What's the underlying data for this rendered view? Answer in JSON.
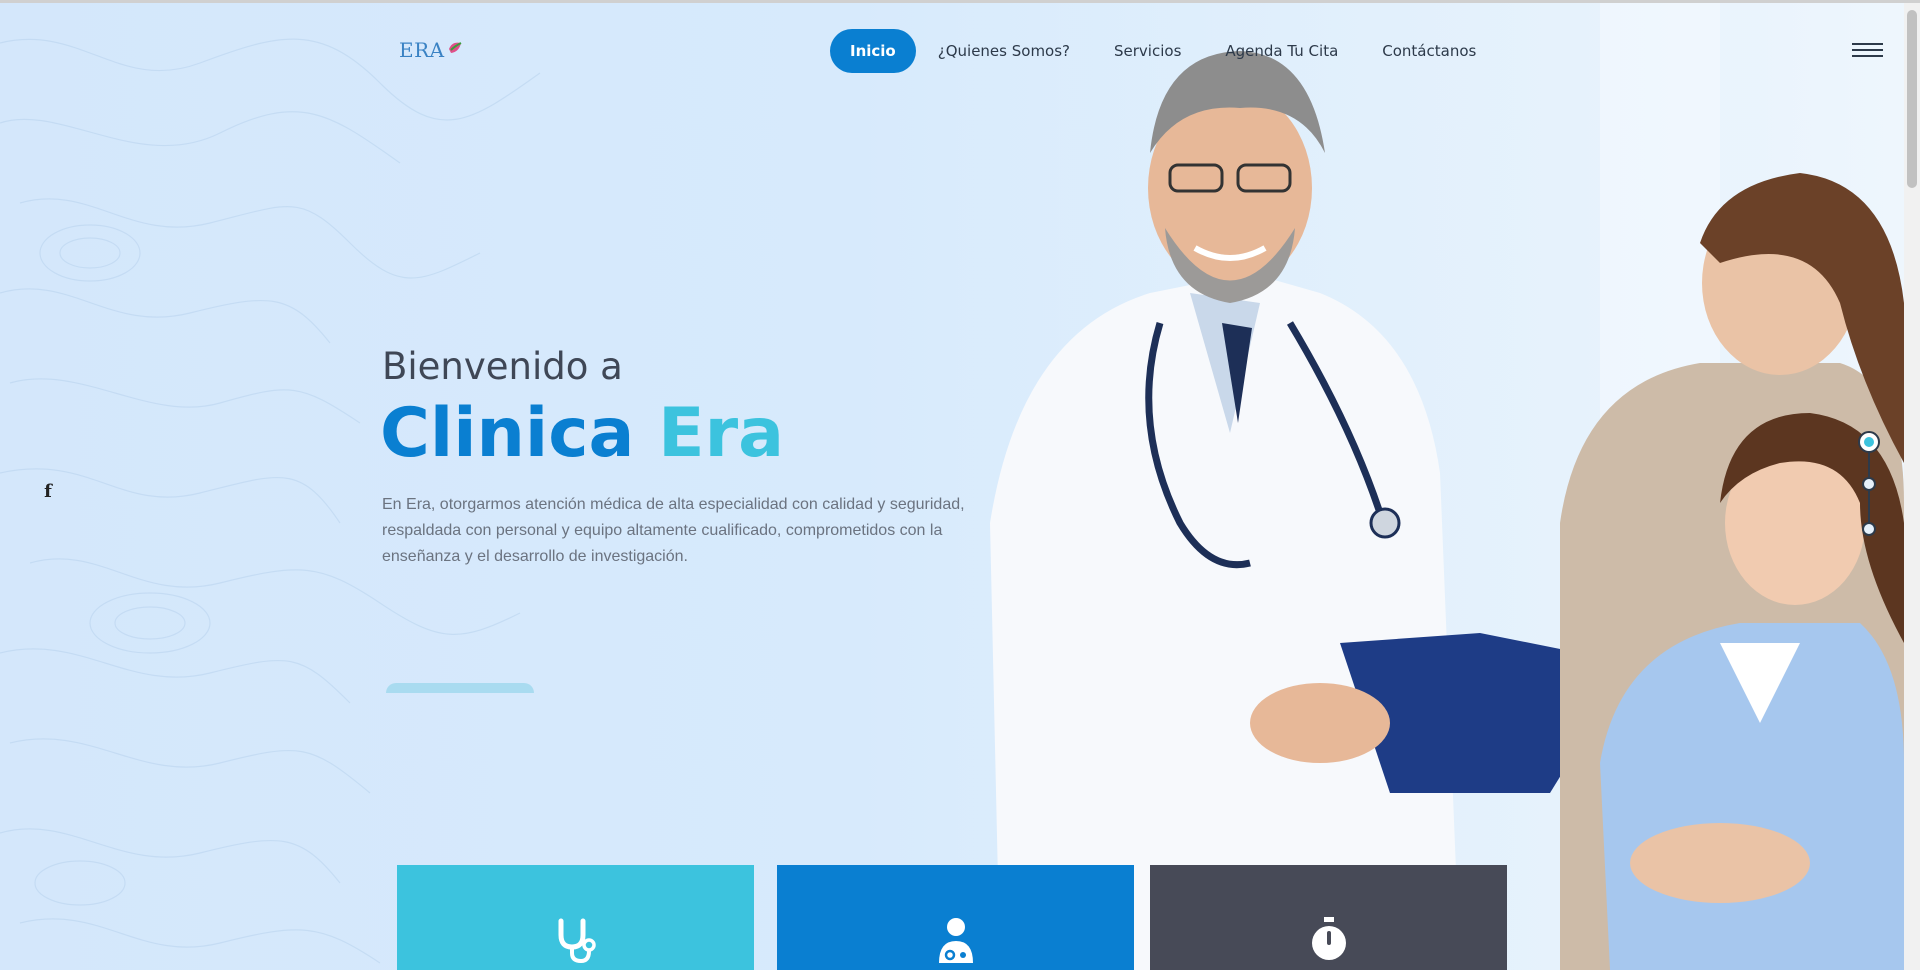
{
  "header": {
    "logo_text": "ERA",
    "nav": [
      {
        "label": "Inicio",
        "active": true
      },
      {
        "label": "¿Quienes Somos?",
        "active": false
      },
      {
        "label": "Servicios",
        "active": false
      },
      {
        "label": "Agenda Tu Cita",
        "active": false
      },
      {
        "label": "Contáctanos",
        "active": false
      }
    ],
    "menu_icon": "hamburger-icon"
  },
  "social": {
    "facebook_glyph": "f"
  },
  "hero": {
    "welcome": "Bienvenido a",
    "title_part1": "Clinica",
    "title_part2": "Era",
    "description": "En Era, otorgarmos atención médica de alta especialidad con calidad y seguridad, respaldada con personal y equipo altamente cualificado, comprometidos con la enseñanza y el desarrollo de investigación."
  },
  "slider": {
    "slides": 3,
    "active_index": 0
  },
  "cards": [
    {
      "icon": "stethoscope-icon",
      "color": "#3cc3de"
    },
    {
      "icon": "doctor-icon",
      "color": "#0a7fd1"
    },
    {
      "icon": "stopwatch-icon",
      "color": "#474a57"
    }
  ],
  "colors": {
    "primary": "#0a7fd1",
    "accent": "#3cc3de",
    "dark": "#474a57",
    "text": "#3f4756"
  }
}
